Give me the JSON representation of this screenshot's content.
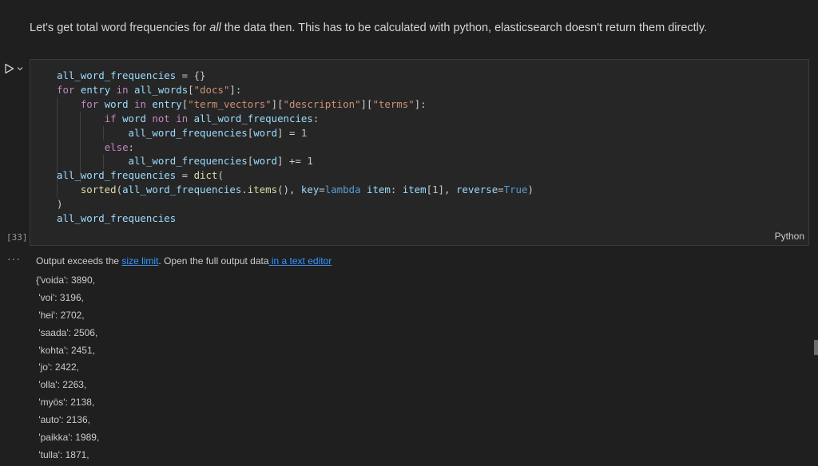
{
  "markdown": {
    "before": "Let's get total word frequencies for ",
    "emphasis": "all",
    "after": " the data then. This has to be calculated with python, elasticsearch doesn't return them directly."
  },
  "cell": {
    "execution_count": "[33]",
    "language": "Python",
    "code_lines": [
      "all_word_frequencies = {}",
      "for entry in all_words[\"docs\"]:",
      "    for word in entry[\"term_vectors\"][\"description\"][\"terms\"]:",
      "        if word not in all_word_frequencies:",
      "            all_word_frequencies[word] = 1",
      "        else:",
      "            all_word_frequencies[word] += 1",
      "all_word_frequencies = dict(",
      "    sorted(all_word_frequencies.items(), key=lambda item: item[1], reverse=True)",
      ")",
      "all_word_frequencies"
    ]
  },
  "output": {
    "more_actions": "···",
    "notice_prefix": "Output exceeds the ",
    "notice_link1": "size limit",
    "notice_middle": ". Open the full output data",
    "notice_link2": " in a text editor",
    "lines": [
      "{'voida': 3890,",
      " 'voi': 3196,",
      " 'hei': 2702,",
      " 'saada': 2506,",
      " 'kohta': 2451,",
      " 'jo': 2422,",
      " 'olla': 2263,",
      " 'myös': 2138,",
      " 'auto': 2136,",
      " 'paikka': 1989,",
      " 'tulla': 1871,"
    ]
  },
  "colors": {
    "background": "#1f1f1f",
    "cell_background": "#262626",
    "link": "#3794ff"
  }
}
